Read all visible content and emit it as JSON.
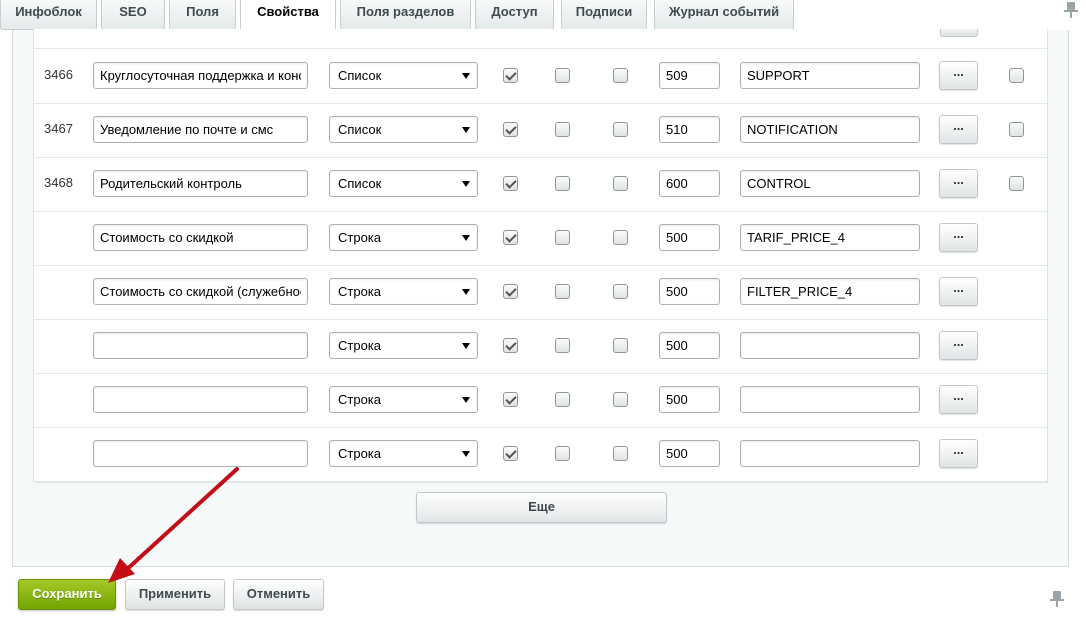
{
  "tabs": [
    {
      "label": "Инфоблок"
    },
    {
      "label": "SEO"
    },
    {
      "label": "Поля"
    },
    {
      "label": "Свойства",
      "active": true
    },
    {
      "label": "Поля разделов"
    },
    {
      "label": "Доступ"
    },
    {
      "label": "Подписи"
    },
    {
      "label": "Журнал событий"
    }
  ],
  "rows": [
    {
      "id": "3466",
      "name": "Круглосуточная поддержка и конс",
      "type": "Список",
      "sort": "509",
      "code": "SUPPORT",
      "checks": [
        true,
        false,
        false
      ],
      "last_check": true
    },
    {
      "id": "3467",
      "name": "Уведомление по почте и смс",
      "type": "Список",
      "sort": "510",
      "code": "NOTIFICATION",
      "checks": [
        true,
        false,
        false
      ],
      "last_check": true
    },
    {
      "id": "3468",
      "name": "Родительский контроль",
      "type": "Список",
      "sort": "600",
      "code": "CONTROL",
      "checks": [
        true,
        false,
        false
      ],
      "last_check": true
    },
    {
      "id": "",
      "name": "Стоимость со скидкой",
      "type": "Строка",
      "sort": "500",
      "code": "TARIF_PRICE_4",
      "checks": [
        true,
        false,
        false
      ],
      "last_check": false
    },
    {
      "id": "",
      "name": "Стоимость со скидкой (служебное",
      "type": "Строка",
      "sort": "500",
      "code": "FILTER_PRICE_4",
      "checks": [
        true,
        false,
        false
      ],
      "last_check": false
    },
    {
      "id": "",
      "name": "",
      "type": "Строка",
      "sort": "500",
      "code": "",
      "checks": [
        true,
        false,
        false
      ],
      "last_check": false
    },
    {
      "id": "",
      "name": "",
      "type": "Строка",
      "sort": "500",
      "code": "",
      "checks": [
        true,
        false,
        false
      ],
      "last_check": false
    },
    {
      "id": "",
      "name": "",
      "type": "Строка",
      "sort": "500",
      "code": "",
      "checks": [
        true,
        false,
        false
      ],
      "last_check": false
    }
  ],
  "dots_label": "...",
  "more_label": "Еще",
  "buttons": {
    "save": "Сохранить",
    "apply": "Применить",
    "cancel": "Отменить"
  },
  "colors": {
    "save_green": "#7cb014",
    "annotation_arrow": "#c40e17"
  }
}
